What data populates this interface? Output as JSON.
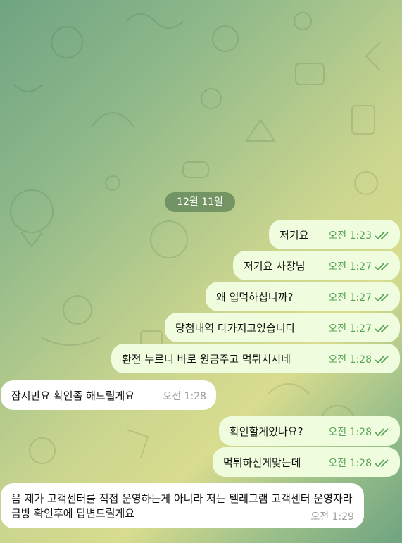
{
  "chat": {
    "date_label": "12월 11일",
    "messages": [
      {
        "dir": "out",
        "text": "저기요",
        "time": "오전 1:23"
      },
      {
        "dir": "out",
        "text": "저기요 사장님",
        "time": "오전 1:27"
      },
      {
        "dir": "out",
        "text": "왜 입먹하십니까?",
        "time": "오전 1:27"
      },
      {
        "dir": "out",
        "text": "당첨내역 다가지고있습니다",
        "time": "오전 1:27"
      },
      {
        "dir": "out",
        "text": "환전 누르니 바로 원금주고 먹튀치시네",
        "time": "오전 1:28"
      },
      {
        "dir": "in",
        "text": "잠시만요 확인좀 해드릴게요",
        "time": "오전 1:28"
      },
      {
        "dir": "out",
        "text": "확인할게있나요?",
        "time": "오전 1:28"
      },
      {
        "dir": "out",
        "text": "먹튀하신게맞는데",
        "time": "오전 1:28"
      },
      {
        "dir": "in",
        "text": "음 제가 고객센터를 직접 운영하는게 아니라 저는 텔레그램 고객센터 운영자라 금방 확인후에 답변드릴게요",
        "time": "오전 1:29"
      }
    ]
  },
  "colors": {
    "outgoing_bubble": "#effdde",
    "incoming_bubble": "#ffffff",
    "tick_green": "#5aa35a",
    "date_pill": "#5f8255"
  },
  "icons": {
    "read_receipt": "double-check-icon",
    "background": "doodle-pattern"
  }
}
